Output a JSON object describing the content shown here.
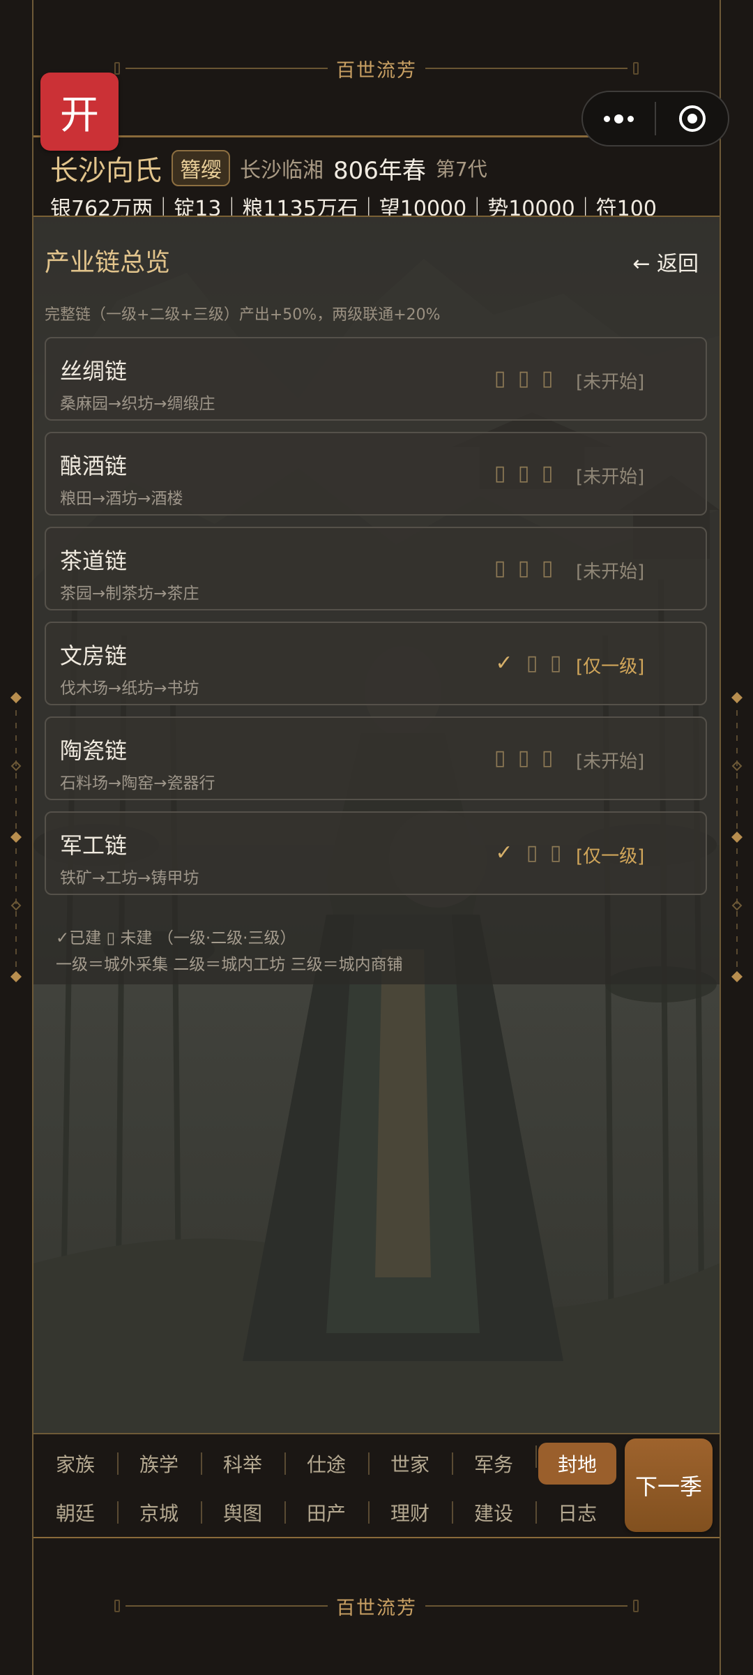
{
  "banner_title": "百世流芳",
  "open_button": "开",
  "header": {
    "clan_name": "长沙向氏",
    "rank": "簪缨",
    "place": "长沙临湘",
    "year": "806年春",
    "generation": "第7代",
    "resources": "银762万两｜锭13｜粮1135万石｜望10000｜势10000｜符100"
  },
  "panel": {
    "title": "产业链总览",
    "back": "← 返回",
    "note": "完整链（一级+二级+三级）产出+50%，两级联通+20%",
    "chains": [
      {
        "name": "丝绸链",
        "path": "桑麻园→织坊→绸缎庄",
        "marks": [
          "▯",
          "▯",
          "▯"
        ],
        "state": "[未开始]",
        "partial": false
      },
      {
        "name": "酿酒链",
        "path": "粮田→酒坊→酒楼",
        "marks": [
          "▯",
          "▯",
          "▯"
        ],
        "state": "[未开始]",
        "partial": false
      },
      {
        "name": "茶道链",
        "path": "茶园→制茶坊→茶庄",
        "marks": [
          "▯",
          "▯",
          "▯"
        ],
        "state": "[未开始]",
        "partial": false
      },
      {
        "name": "文房链",
        "path": "伐木场→纸坊→书坊",
        "marks": [
          "✓",
          "▯",
          "▯"
        ],
        "state": "[仅一级]",
        "partial": true
      },
      {
        "name": "陶瓷链",
        "path": "石料场→陶窑→瓷器行",
        "marks": [
          "▯",
          "▯",
          "▯"
        ],
        "state": "[未开始]",
        "partial": false
      },
      {
        "name": "军工链",
        "path": "铁矿→工坊→铸甲坊",
        "marks": [
          "✓",
          "▯",
          "▯"
        ],
        "state": "[仅一级]",
        "partial": true
      }
    ],
    "legend_line1": "✓已建 ▯ 未建 （一级·二级·三级）",
    "legend_line2": "一级＝城外采集 二级＝城内工坊 三级＝城内商铺"
  },
  "nav": {
    "row1": [
      "家族",
      "族学",
      "科举",
      "仕途",
      "世家",
      "军务",
      "封地"
    ],
    "row2": [
      "朝廷",
      "京城",
      "舆图",
      "田产",
      "理财",
      "建设",
      "日志"
    ],
    "active": "封地",
    "next": "下一季"
  }
}
